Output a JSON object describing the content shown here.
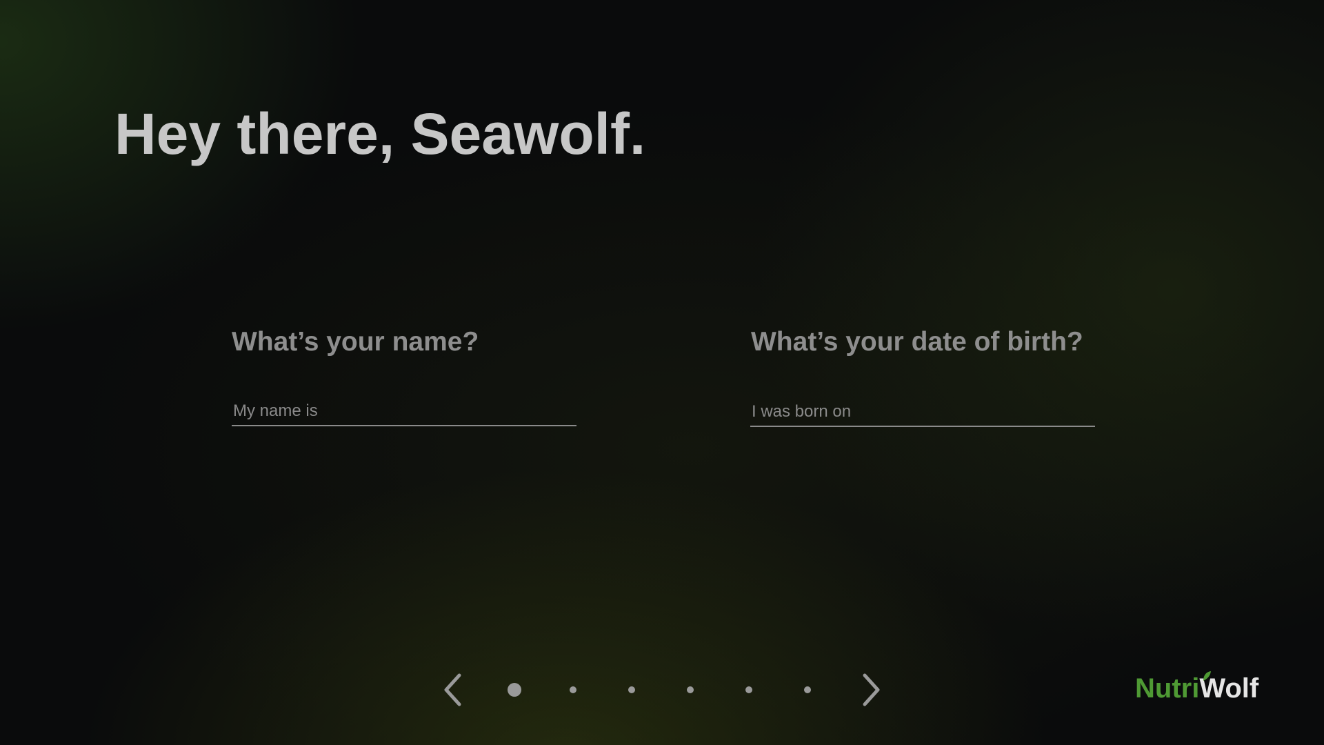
{
  "greeting": "Hey there, Seawolf.",
  "form": {
    "name_question": "What’s your name?",
    "name_placeholder": "My name is",
    "name_value": "",
    "dob_question": "What’s your date of birth?",
    "dob_placeholder": "I was born on",
    "dob_value": ""
  },
  "pagination": {
    "total_steps": 6,
    "current_step": 1,
    "prev_icon": "chevron-left-icon",
    "next_icon": "chevron-right-icon"
  },
  "brand": {
    "name_part1": "Nutri",
    "name_part2": "Wolf",
    "color_primary": "#4f9a34",
    "color_secondary": "#e6e6e6"
  },
  "colors": {
    "heading": "#c7c7c7",
    "question": "#8e8e8e",
    "underline": "#8a8a8a",
    "dot": "#9a9a9a"
  }
}
